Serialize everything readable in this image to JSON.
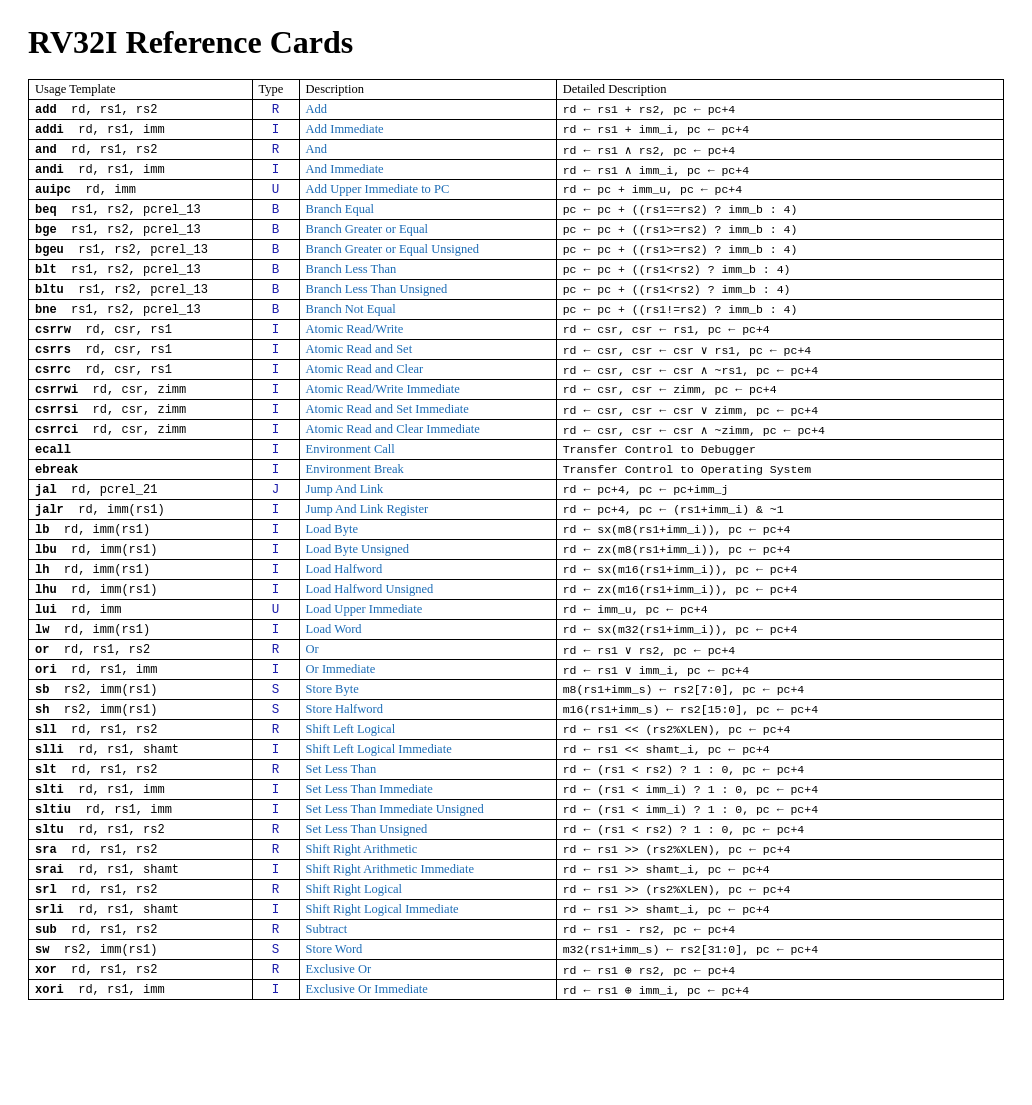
{
  "title": "RV32I Reference Cards",
  "table": {
    "headers": [
      "Usage Template",
      "Type",
      "Description",
      "Detailed Description"
    ],
    "rows": [
      {
        "mnemonic": "add",
        "usage": "rd, rs1, rs2",
        "type": "R",
        "desc": "Add",
        "detail": "rd ← rs1 + rs2, pc ← pc+4"
      },
      {
        "mnemonic": "addi",
        "usage": "rd, rs1, imm",
        "type": "I",
        "desc": "Add Immediate",
        "detail": "rd ← rs1 + imm_i, pc ← pc+4"
      },
      {
        "mnemonic": "and",
        "usage": "rd, rs1, rs2",
        "type": "R",
        "desc": "And",
        "detail": "rd ← rs1 ∧ rs2, pc ← pc+4"
      },
      {
        "mnemonic": "andi",
        "usage": "rd, rs1, imm",
        "type": "I",
        "desc": "And Immediate",
        "detail": "rd ← rs1 ∧ imm_i, pc ← pc+4"
      },
      {
        "mnemonic": "auipc",
        "usage": "rd, imm",
        "type": "U",
        "desc": "Add Upper Immediate to PC",
        "detail": "rd ← pc + imm_u, pc ← pc+4"
      },
      {
        "mnemonic": "beq",
        "usage": "rs1, rs2, pcrel_13",
        "type": "B",
        "desc": "Branch Equal",
        "detail": "pc ← pc + ((rs1==rs2) ? imm_b : 4)"
      },
      {
        "mnemonic": "bge",
        "usage": "rs1, rs2, pcrel_13",
        "type": "B",
        "desc": "Branch Greater or Equal",
        "detail": "pc ← pc + ((rs1>=rs2) ? imm_b : 4)"
      },
      {
        "mnemonic": "bgeu",
        "usage": "rs1, rs2, pcrel_13",
        "type": "B",
        "desc": "Branch Greater or Equal Unsigned",
        "detail": "pc ← pc + ((rs1>=rs2) ? imm_b : 4)"
      },
      {
        "mnemonic": "blt",
        "usage": "rs1, rs2, pcrel_13",
        "type": "B",
        "desc": "Branch Less Than",
        "detail": "pc ← pc + ((rs1<rs2) ? imm_b : 4)"
      },
      {
        "mnemonic": "bltu",
        "usage": "rs1, rs2, pcrel_13",
        "type": "B",
        "desc": "Branch Less Than Unsigned",
        "detail": "pc ← pc + ((rs1<rs2) ? imm_b : 4)"
      },
      {
        "mnemonic": "bne",
        "usage": "rs1, rs2, pcrel_13",
        "type": "B",
        "desc": "Branch Not Equal",
        "detail": "pc ← pc + ((rs1!=rs2) ? imm_b : 4)"
      },
      {
        "mnemonic": "csrrw",
        "usage": "rd, csr, rs1",
        "type": "I",
        "desc": "Atomic Read/Write",
        "detail": "rd ← csr, csr ← rs1, pc ← pc+4"
      },
      {
        "mnemonic": "csrrs",
        "usage": "rd, csr, rs1",
        "type": "I",
        "desc": "Atomic Read and Set",
        "detail": "rd ← csr, csr ← csr ∨ rs1, pc ← pc+4"
      },
      {
        "mnemonic": "csrrc",
        "usage": "rd, csr, rs1",
        "type": "I",
        "desc": "Atomic Read and Clear",
        "detail": "rd ← csr, csr ← csr ∧ ~rs1, pc ← pc+4"
      },
      {
        "mnemonic": "csrrwi",
        "usage": "rd, csr, zimm",
        "type": "I",
        "desc": "Atomic Read/Write Immediate",
        "detail": "rd ← csr, csr ← zimm, pc ← pc+4"
      },
      {
        "mnemonic": "csrrsi",
        "usage": "rd, csr, zimm",
        "type": "I",
        "desc": "Atomic Read and Set Immediate",
        "detail": "rd ← csr, csr ← csr ∨ zimm, pc ← pc+4"
      },
      {
        "mnemonic": "csrrci",
        "usage": "rd, csr, zimm",
        "type": "I",
        "desc": "Atomic Read and Clear Immediate",
        "detail": "rd ← csr, csr ← csr ∧ ~zimm, pc ← pc+4"
      },
      {
        "mnemonic": "ecall",
        "usage": "",
        "type": "I",
        "desc": "Environment Call",
        "detail": "Transfer Control to Debugger"
      },
      {
        "mnemonic": "ebreak",
        "usage": "",
        "type": "I",
        "desc": "Environment Break",
        "detail": "Transfer Control to Operating System"
      },
      {
        "mnemonic": "jal",
        "usage": "rd, pcrel_21",
        "type": "J",
        "desc": "Jump And Link",
        "detail": "rd ← pc+4, pc ← pc+imm_j"
      },
      {
        "mnemonic": "jalr",
        "usage": "rd, imm(rs1)",
        "type": "I",
        "desc": "Jump And Link Register",
        "detail": "rd ← pc+4, pc ← (rs1+imm_i) & ~1"
      },
      {
        "mnemonic": "lb",
        "usage": "rd, imm(rs1)",
        "type": "I",
        "desc": "Load Byte",
        "detail": "rd ← sx(m8(rs1+imm_i)), pc ← pc+4"
      },
      {
        "mnemonic": "lbu",
        "usage": "rd, imm(rs1)",
        "type": "I",
        "desc": "Load Byte Unsigned",
        "detail": "rd ← zx(m8(rs1+imm_i)), pc ← pc+4"
      },
      {
        "mnemonic": "lh",
        "usage": "rd, imm(rs1)",
        "type": "I",
        "desc": "Load Halfword",
        "detail": "rd ← sx(m16(rs1+imm_i)), pc ← pc+4"
      },
      {
        "mnemonic": "lhu",
        "usage": "rd, imm(rs1)",
        "type": "I",
        "desc": "Load Halfword Unsigned",
        "detail": "rd ← zx(m16(rs1+imm_i)), pc ← pc+4"
      },
      {
        "mnemonic": "lui",
        "usage": "rd, imm",
        "type": "U",
        "desc": "Load Upper Immediate",
        "detail": "rd ← imm_u, pc ← pc+4"
      },
      {
        "mnemonic": "lw",
        "usage": "rd, imm(rs1)",
        "type": "I",
        "desc": "Load Word",
        "detail": "rd ← sx(m32(rs1+imm_i)), pc ← pc+4"
      },
      {
        "mnemonic": "or",
        "usage": "rd, rs1, rs2",
        "type": "R",
        "desc": "Or",
        "detail": "rd ← rs1 ∨ rs2, pc ← pc+4"
      },
      {
        "mnemonic": "ori",
        "usage": "rd, rs1, imm",
        "type": "I",
        "desc": "Or Immediate",
        "detail": "rd ← rs1 ∨ imm_i, pc ← pc+4"
      },
      {
        "mnemonic": "sb",
        "usage": "rs2, imm(rs1)",
        "type": "S",
        "desc": "Store Byte",
        "detail": "m8(rs1+imm_s) ← rs2[7:0], pc ← pc+4"
      },
      {
        "mnemonic": "sh",
        "usage": "rs2, imm(rs1)",
        "type": "S",
        "desc": "Store Halfword",
        "detail": "m16(rs1+imm_s) ← rs2[15:0], pc ← pc+4"
      },
      {
        "mnemonic": "sll",
        "usage": "rd, rs1, rs2",
        "type": "R",
        "desc": "Shift Left Logical",
        "detail": "rd ← rs1 << (rs2%XLEN), pc ← pc+4"
      },
      {
        "mnemonic": "slli",
        "usage": "rd, rs1, shamt",
        "type": "I",
        "desc": "Shift Left Logical Immediate",
        "detail": "rd ← rs1 << shamt_i, pc ← pc+4"
      },
      {
        "mnemonic": "slt",
        "usage": "rd, rs1, rs2",
        "type": "R",
        "desc": "Set Less Than",
        "detail": "rd ← (rs1 < rs2) ? 1 : 0, pc ← pc+4"
      },
      {
        "mnemonic": "slti",
        "usage": "rd, rs1, imm",
        "type": "I",
        "desc": "Set Less Than Immediate",
        "detail": "rd ← (rs1 < imm_i) ? 1 : 0, pc ← pc+4"
      },
      {
        "mnemonic": "sltiu",
        "usage": "rd, rs1, imm",
        "type": "I",
        "desc": "Set Less Than Immediate Unsigned",
        "detail": "rd ← (rs1 < imm_i) ? 1 : 0, pc ← pc+4"
      },
      {
        "mnemonic": "sltu",
        "usage": "rd, rs1, rs2",
        "type": "R",
        "desc": "Set Less Than Unsigned",
        "detail": "rd ← (rs1 < rs2) ? 1 : 0, pc ← pc+4"
      },
      {
        "mnemonic": "sra",
        "usage": "rd, rs1, rs2",
        "type": "R",
        "desc": "Shift Right Arithmetic",
        "detail": "rd ← rs1 >> (rs2%XLEN), pc ← pc+4"
      },
      {
        "mnemonic": "srai",
        "usage": "rd, rs1, shamt",
        "type": "I",
        "desc": "Shift Right Arithmetic Immediate",
        "detail": "rd ← rs1 >> shamt_i, pc ← pc+4"
      },
      {
        "mnemonic": "srl",
        "usage": "rd, rs1, rs2",
        "type": "R",
        "desc": "Shift Right Logical",
        "detail": "rd ← rs1 >> (rs2%XLEN), pc ← pc+4"
      },
      {
        "mnemonic": "srli",
        "usage": "rd, rs1, shamt",
        "type": "I",
        "desc": "Shift Right Logical Immediate",
        "detail": "rd ← rs1 >> shamt_i, pc ← pc+4"
      },
      {
        "mnemonic": "sub",
        "usage": "rd, rs1, rs2",
        "type": "R",
        "desc": "Subtract",
        "detail": "rd ← rs1 - rs2, pc ← pc+4"
      },
      {
        "mnemonic": "sw",
        "usage": "rs2, imm(rs1)",
        "type": "S",
        "desc": "Store Word",
        "detail": "m32(rs1+imm_s) ← rs2[31:0], pc ← pc+4"
      },
      {
        "mnemonic": "xor",
        "usage": "rd, rs1, rs2",
        "type": "R",
        "desc": "Exclusive Or",
        "detail": "rd ← rs1 ⊕ rs2, pc ← pc+4"
      },
      {
        "mnemonic": "xori",
        "usage": "rd, rs1, imm",
        "type": "I",
        "desc": "Exclusive Or Immediate",
        "detail": "rd ← rs1 ⊕ imm_i, pc ← pc+4"
      }
    ]
  }
}
